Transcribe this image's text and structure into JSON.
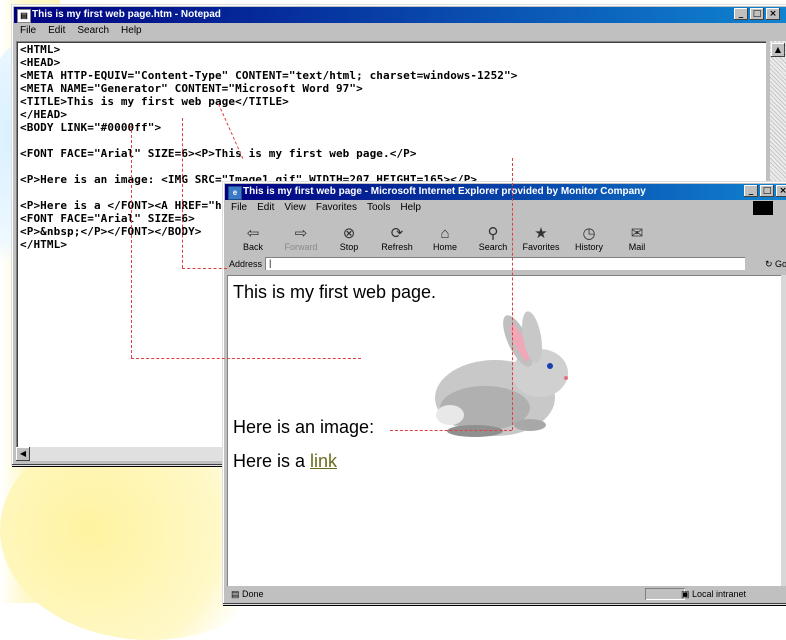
{
  "notepad": {
    "title": "This is my first web page.htm - Notepad",
    "menu": [
      "File",
      "Edit",
      "Search",
      "Help"
    ],
    "code_lines": [
      "<HTML>",
      "<HEAD>",
      "<META HTTP-EQUIV=\"Content-Type\" CONTENT=\"text/html; charset=windows-1252\">",
      "<META NAME=\"Generator\" CONTENT=\"Microsoft Word 97\">",
      "<TITLE>This is my first web page</TITLE>",
      "</HEAD>",
      "<BODY LINK=\"#0000ff\">",
      "",
      "<FONT FACE=\"Arial\" SIZE=6><P>This is my first web page.</P>",
      "",
      "<P>Here is an image: <IMG SRC=\"Image1.gif\" WIDTH=207 HEIGHT=165></P>",
      "",
      "<P>Here is a </FONT><A HREF=\"h",
      "<FONT FACE=\"Arial\" SIZE=6>",
      "<P>&nbsp;</P></FONT></BODY>",
      "</HTML>"
    ]
  },
  "ie": {
    "title": "This is my first web page - Microsoft Internet Explorer provided by Monitor Company",
    "menu": [
      "File",
      "Edit",
      "View",
      "Favorites",
      "Tools",
      "Help"
    ],
    "toolbar": [
      {
        "label": "Back",
        "icon": "back-arrow-icon",
        "glyph": "⇦",
        "disabled": false
      },
      {
        "label": "Forward",
        "icon": "forward-arrow-icon",
        "glyph": "⇨",
        "disabled": true
      },
      {
        "label": "Stop",
        "icon": "stop-icon",
        "glyph": "⊗",
        "disabled": false
      },
      {
        "label": "Refresh",
        "icon": "refresh-icon",
        "glyph": "⟳",
        "disabled": false
      },
      {
        "label": "Home",
        "icon": "home-icon",
        "glyph": "⌂",
        "disabled": false
      },
      {
        "label": "Search",
        "icon": "search-icon",
        "glyph": "⚲",
        "disabled": false
      },
      {
        "label": "Favorites",
        "icon": "favorites-icon",
        "glyph": "★",
        "disabled": false
      },
      {
        "label": "History",
        "icon": "history-icon",
        "glyph": "◷",
        "disabled": false
      },
      {
        "label": "Mail",
        "icon": "mail-icon",
        "glyph": "✉",
        "disabled": false
      }
    ],
    "address_label": "Address",
    "address_value": "|",
    "go_label": "Go",
    "page": {
      "heading": "This is my first web page.",
      "image_text": "Here is an image:",
      "link_prefix": "Here is a ",
      "link_text": "link"
    },
    "status_left": "Done",
    "status_right": "Local intranet"
  }
}
